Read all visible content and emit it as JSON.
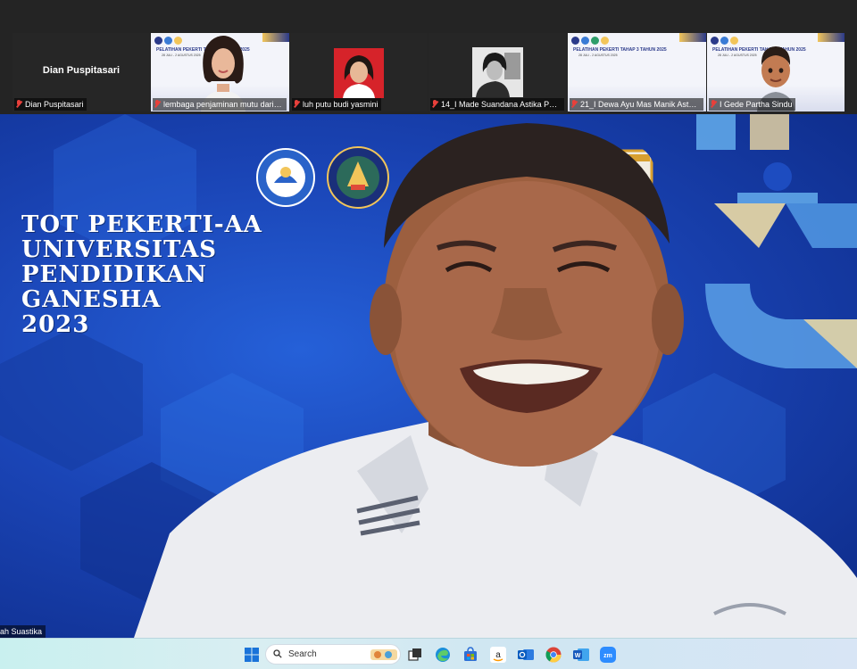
{
  "meeting": {
    "app": "Zoom",
    "participants": [
      {
        "name": "Dian Puspitasari",
        "muted": true,
        "video": false
      },
      {
        "name": "lembaga penjaminan mutu dari pen...",
        "muted": true,
        "video": true
      },
      {
        "name": "luh putu budi yasmini",
        "muted": true,
        "video": true
      },
      {
        "name": "14_I Made Suandana Astika Pande",
        "muted": true,
        "video": true
      },
      {
        "name": "21_I Dewa Ayu Mas Manik Astaw...",
        "muted": true,
        "video": true
      },
      {
        "name": "I Gede Partha Sindu",
        "muted": true,
        "video": true
      }
    ],
    "placeholder_name": "Dian Puspitasari",
    "slide_mini": {
      "title_a": "PELATIHAN PEKERTI TAHAP 3 TAHUN 2025",
      "dates": "28 JULI - 2 AGUSTUS 2025",
      "title_b": "PELATIHAN PEKERTI TAHAP 3 TAHUN 2025",
      "url": "https://pekerti.undiksha.ac.id"
    },
    "main_speaker": {
      "name_tag": "ah Suastika",
      "background_lines": [
        "TOT PEKERTI-AA",
        "UNIVERSITAS",
        "PENDIDIKAN",
        "GANESHA",
        "2023"
      ]
    }
  },
  "taskbar": {
    "search_label": "Search",
    "icons": [
      "windows-start-icon",
      "search-icon",
      "task-view-icon",
      "edge-icon",
      "store-icon",
      "amazon-icon",
      "outlook-icon",
      "chrome-icon",
      "word-icon",
      "zoom-icon"
    ]
  },
  "colors": {
    "stage_blue": "#1a44b5",
    "taskbar": "#d4ecf2",
    "mute_red": "#e8403b",
    "zoom_blue": "#2d8cff"
  }
}
